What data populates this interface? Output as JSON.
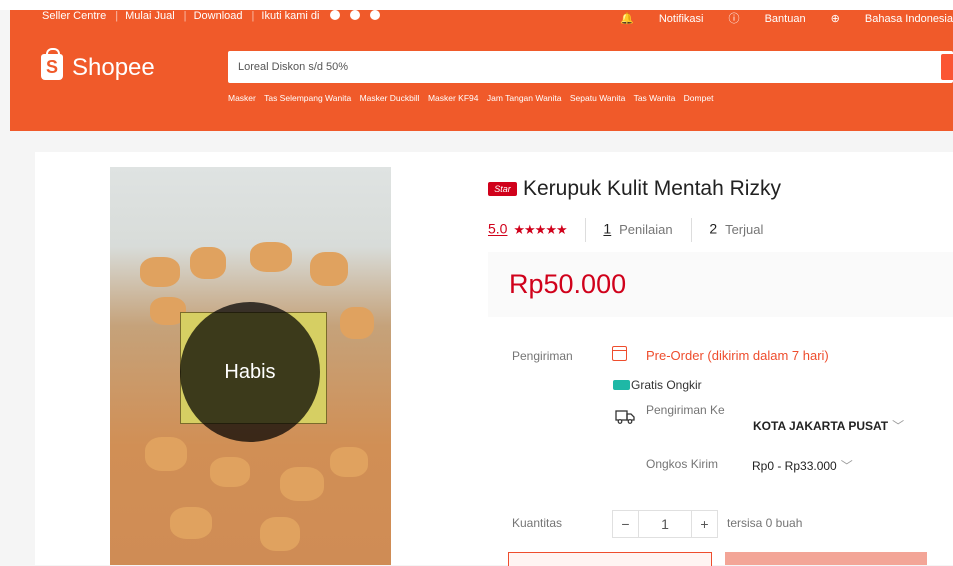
{
  "topbar": {
    "links": [
      "Seller Centre",
      "Mulai Jual",
      "Download",
      "Ikuti kami di"
    ],
    "right": [
      "Notifikasi",
      "Bantuan",
      "Bahasa Indonesia"
    ]
  },
  "header": {
    "logo_text": "Shopee",
    "search_value": "Loreal Diskon s/d 50%",
    "suggestions": [
      "Masker",
      "Tas Selempang Wanita",
      "Masker Duckbill",
      "Masker KF94",
      "Jam Tangan Wanita",
      "Sepatu Wanita",
      "Tas Wanita",
      "Dompet"
    ]
  },
  "product": {
    "badge": "Star",
    "title": "Kerupuk Kulit Mentah Rizky",
    "rating": "5.0",
    "stars": "★★★★★",
    "rating_count": "1",
    "rating_label": "Penilaian",
    "sold_count": "2",
    "sold_label": "Terjual",
    "price": "Rp50.000",
    "out_of_stock_label": "Habis"
  },
  "shipping": {
    "label": "Pengiriman",
    "preorder": "Pre-Order (dikirim dalam 7 hari)",
    "free": "Gratis Ongkir",
    "to_label": "Pengiriman Ke",
    "to_value": "KOTA JAKARTA PUSAT",
    "cost_label": "Ongkos Kirim",
    "cost_value": "Rp0 - Rp33.000"
  },
  "quantity": {
    "label": "Kuantitas",
    "minus": "−",
    "value": "1",
    "plus": "+",
    "stock": "tersisa 0 buah"
  },
  "colors": {
    "brand": "#f05a2a",
    "price": "#d0011b",
    "accent": "#ee4d2d"
  }
}
